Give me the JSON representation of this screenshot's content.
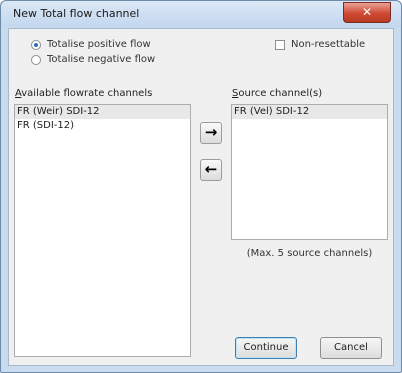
{
  "window": {
    "title": "New Total flow channel",
    "close_glyph": "✕"
  },
  "options": {
    "positive_label": "Totalise positive flow",
    "negative_label": "Totalise negative flow",
    "selected": "positive",
    "nonresettable_label": "Non-resettable",
    "nonresettable_checked": false
  },
  "available": {
    "label_first": "A",
    "label_rest": "vailable flowrate channels",
    "items": [
      "FR (Weir) SDI-12",
      "FR (SDI-12)"
    ],
    "selected_index": 0
  },
  "source": {
    "label_first": "S",
    "label_rest": "ource channel(s)",
    "items": [
      "FR (Vel) SDI-12"
    ],
    "selected_index": 0,
    "note": "(Max. 5 source channels)"
  },
  "buttons": {
    "add_glyph": "→",
    "remove_glyph": "←",
    "continue_label": "Continue",
    "cancel_label": "Cancel"
  },
  "colors": {
    "frame": "#c9dbef",
    "close": "#cf4a33",
    "radio_dot": "#2a6fc4"
  }
}
